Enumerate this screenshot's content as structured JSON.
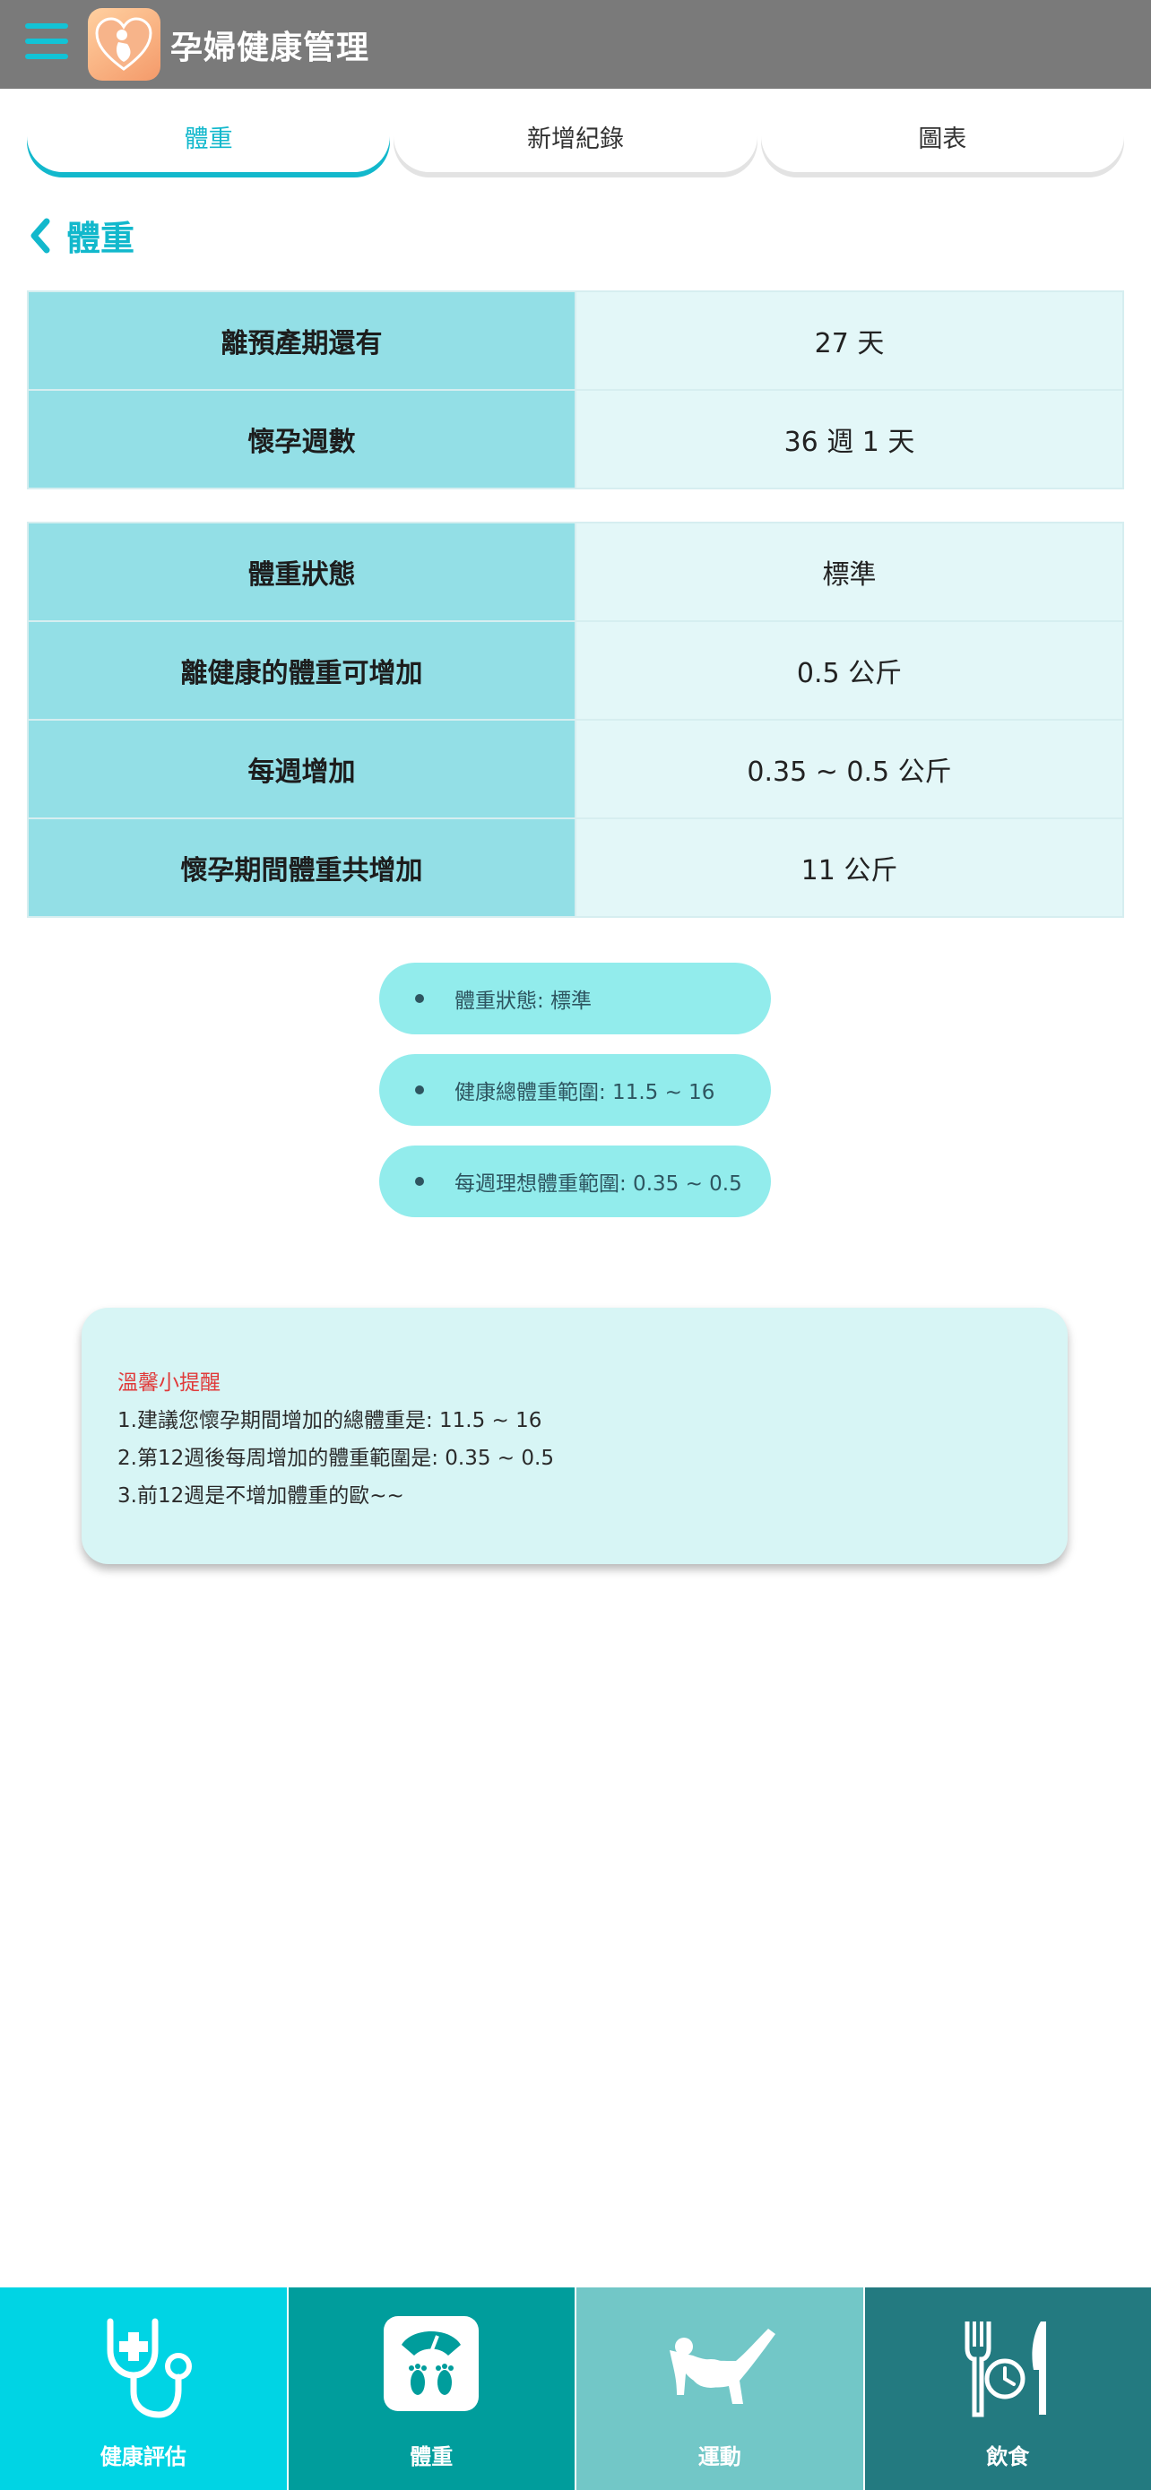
{
  "header": {
    "title": "孕婦健康管理",
    "accent": "#12c3d6"
  },
  "tabs": [
    {
      "label": "體重",
      "active": true
    },
    {
      "label": "新增紀錄",
      "active": false
    },
    {
      "label": "圖表",
      "active": false
    }
  ],
  "page": {
    "title": "體重"
  },
  "summary_table": [
    {
      "label": "離預產期還有",
      "value": "27 天"
    },
    {
      "label": "懷孕週數",
      "value": "36 週 1 天"
    }
  ],
  "weight_table": [
    {
      "label": "體重狀態",
      "value": "標準"
    },
    {
      "label": "離健康的體重可增加",
      "value": "0.5 公斤"
    },
    {
      "label": "每週增加",
      "value": "0.35 ~ 0.5 公斤"
    },
    {
      "label": "懷孕期間體重共增加",
      "value": "11 公斤"
    }
  ],
  "pills": [
    "體重狀態: 標準",
    "健康總體重範圍: 11.5 ~ 16",
    "每週理想體重範圍: 0.35 ~ 0.5"
  ],
  "tips": {
    "title": "溫馨小提醒",
    "lines": [
      "1.建議您懷孕期間增加的總體重是: 11.5 ~ 16",
      "2.第12週後每周增加的體重範圍是: 0.35 ~ 0.5",
      "3.前12週是不增加體重的歐~~"
    ]
  },
  "bottom_nav": [
    {
      "label": "健康評估",
      "icon": "stethoscope-icon",
      "color": "#00d4e4"
    },
    {
      "label": "體重",
      "icon": "scale-icon",
      "color": "#009d9c"
    },
    {
      "label": "運動",
      "icon": "exercise-icon",
      "color": "#72c7c7"
    },
    {
      "label": "飲食",
      "icon": "meal-clock-icon",
      "color": "#237a80"
    }
  ]
}
